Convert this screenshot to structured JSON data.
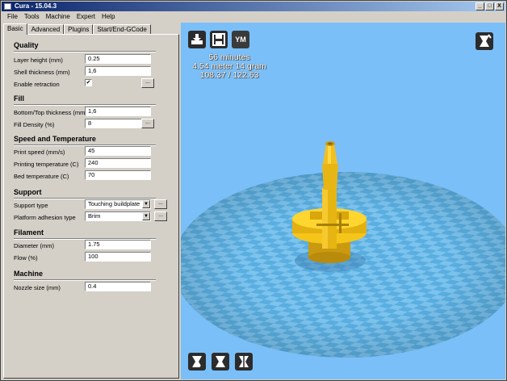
{
  "window": {
    "title": "Cura - 15.04.3",
    "minimize": "_",
    "maximize": "□",
    "close": "X"
  },
  "menu": [
    "File",
    "Tools",
    "Machine",
    "Expert",
    "Help"
  ],
  "tabs": [
    "Basic",
    "Advanced",
    "Plugins",
    "Start/End-GCode"
  ],
  "sections": {
    "quality": {
      "title": "Quality",
      "layer_height": {
        "label": "Layer height (mm)",
        "value": "0.25"
      },
      "shell_thickness": {
        "label": "Shell thickness (mm)",
        "value": "1,6"
      },
      "enable_retraction": {
        "label": "Enable retraction",
        "checked": "✔",
        "button": "..."
      }
    },
    "fill": {
      "title": "Fill",
      "bottom_top": {
        "label": "Bottom/Top thickness (mm)",
        "value": "1,6"
      },
      "density": {
        "label": "Fill Density (%)",
        "value": "8",
        "button": "..."
      }
    },
    "speed": {
      "title": "Speed and Temperature",
      "print_speed": {
        "label": "Print speed (mm/s)",
        "value": "45"
      },
      "print_temp": {
        "label": "Printing temperature (C)",
        "value": "240"
      },
      "bed_temp": {
        "label": "Bed temperature (C)",
        "value": "70"
      }
    },
    "support": {
      "title": "Support",
      "support_type": {
        "label": "Support type",
        "value": "Touching buildplate",
        "button": "..."
      },
      "adhesion": {
        "label": "Platform adhesion type",
        "value": "Brim",
        "button": "..."
      }
    },
    "filament": {
      "title": "Filament",
      "diameter": {
        "label": "Diameter (mm)",
        "value": "1.75"
      },
      "flow": {
        "label": "Flow (%)",
        "value": "100"
      }
    },
    "machine": {
      "title": "Machine",
      "nozzle": {
        "label": "Nozzle size (mm)",
        "value": "0.4"
      }
    }
  },
  "viewport": {
    "ym_button": "YM",
    "print_time": "56 minutes",
    "material": "4.54 meter 14 gram",
    "cost": "108.37 / 122.63",
    "background_color": "#7abff8",
    "model_color": "#f5c51a"
  }
}
